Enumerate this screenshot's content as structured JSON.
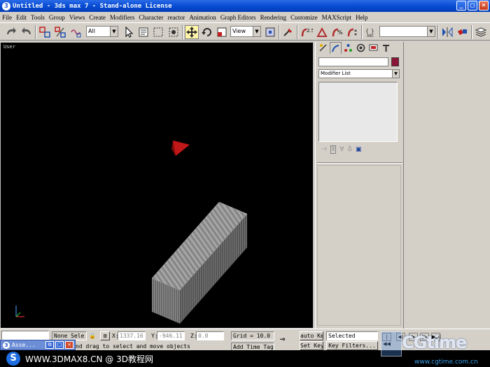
{
  "window": {
    "title": "Untitled  - 3ds max 7  - Stand-alone License",
    "app_icon": "3",
    "controls": [
      "minimize-icon",
      "maximize-icon",
      "close-icon"
    ]
  },
  "menu": [
    "File",
    "Edit",
    "Tools",
    "Group",
    "Views",
    "Create",
    "Modifiers",
    "Character",
    "reactor",
    "Animation",
    "Graph Editors",
    "Rendering",
    "Customize",
    "MAXScript",
    "Help"
  ],
  "toolbar": {
    "selection_filter": "All",
    "reference_coord": "View",
    "named_selection": ""
  },
  "viewport": {
    "label": "User"
  },
  "command_panel": {
    "object_name": "",
    "object_color": "#8a1538",
    "modifier_list": "Modifier List"
  },
  "status": {
    "selection": "None Sele",
    "x_label": "X:",
    "x_value": "1337.16",
    "y_label": "Y:",
    "y_value": "-946.11",
    "z_label": "Z:",
    "z_value": "0.0",
    "grid": "Grid = 10.0",
    "auto_key": "auto Ke",
    "set_key": "Set Key",
    "key_mode": "Selected",
    "key_filters": "Key Filters...",
    "add_time_tag": "Add Time Tag",
    "prompt": "nd drag to select and move objects"
  },
  "taskbar": {
    "title": "Asse..."
  },
  "watermark": {
    "text": "WWW.3DMAX8.CN @ 3D教程网",
    "logo_text": "CGtime",
    "logo_url": "www.cgtime.com.cn"
  },
  "colors": {
    "viewport_bg": "#000000",
    "object_color": "#8a1538",
    "titlebar": "#0a4fd6"
  }
}
